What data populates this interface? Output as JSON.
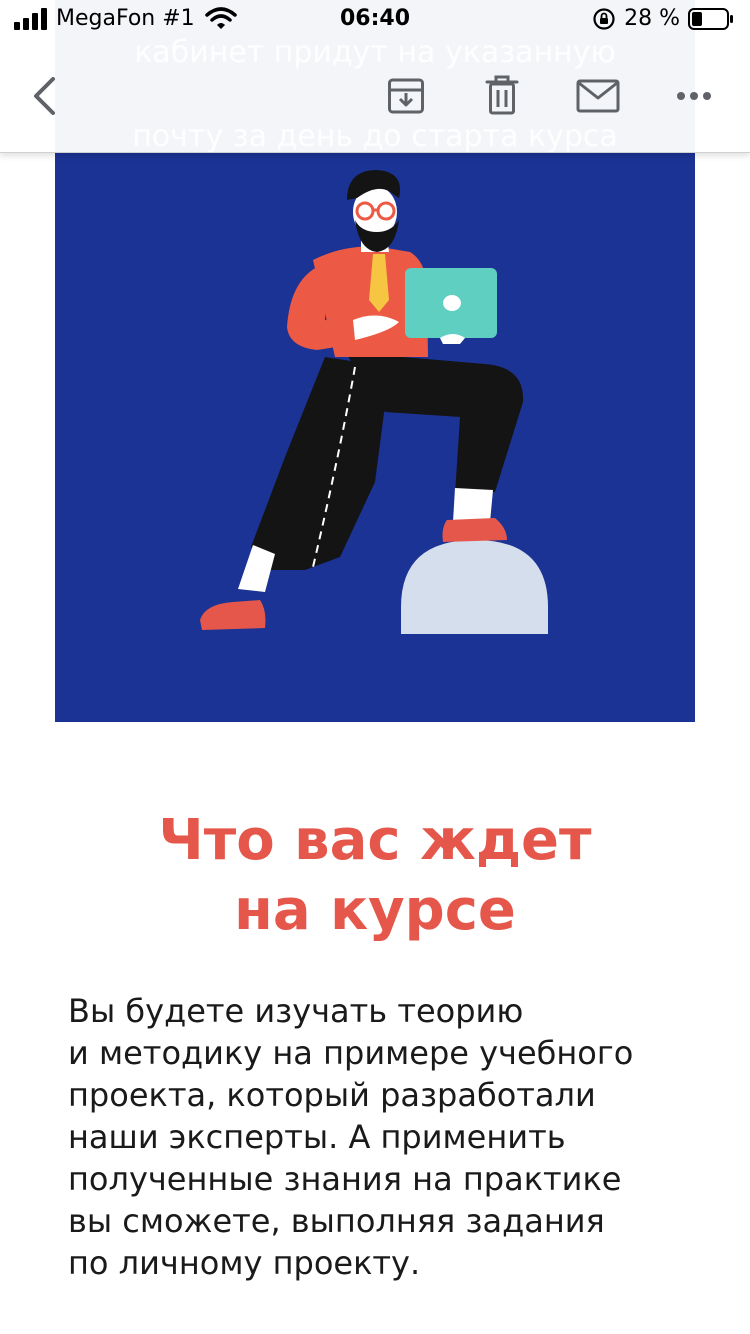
{
  "status_bar": {
    "carrier": "MegaFon #1",
    "time": "06:40",
    "battery_percent": "28 %"
  },
  "email_toolbar": {
    "scrolled_text_lines": [
      "кабинет придут на указанную",
      "почту за день до старта курса"
    ],
    "icons": [
      "back-chevron-icon",
      "archive-icon",
      "trash-icon",
      "mail-icon",
      "more-icon"
    ]
  },
  "content": {
    "heading_lines": [
      "Что вас ждет",
      "на курсе"
    ],
    "paragraph_lines": [
      "Вы будете изучать теорию",
      "и методику на примере учебного",
      "проекта, который разработали",
      "наши эксперты. А применить",
      "полученные знания на практике",
      "вы сможете, выполняя задания",
      "по личному проекту."
    ]
  },
  "colors": {
    "hero_background": "#1b3394",
    "heading": "#e5574a",
    "toolbar_icons": "#5f6368"
  }
}
